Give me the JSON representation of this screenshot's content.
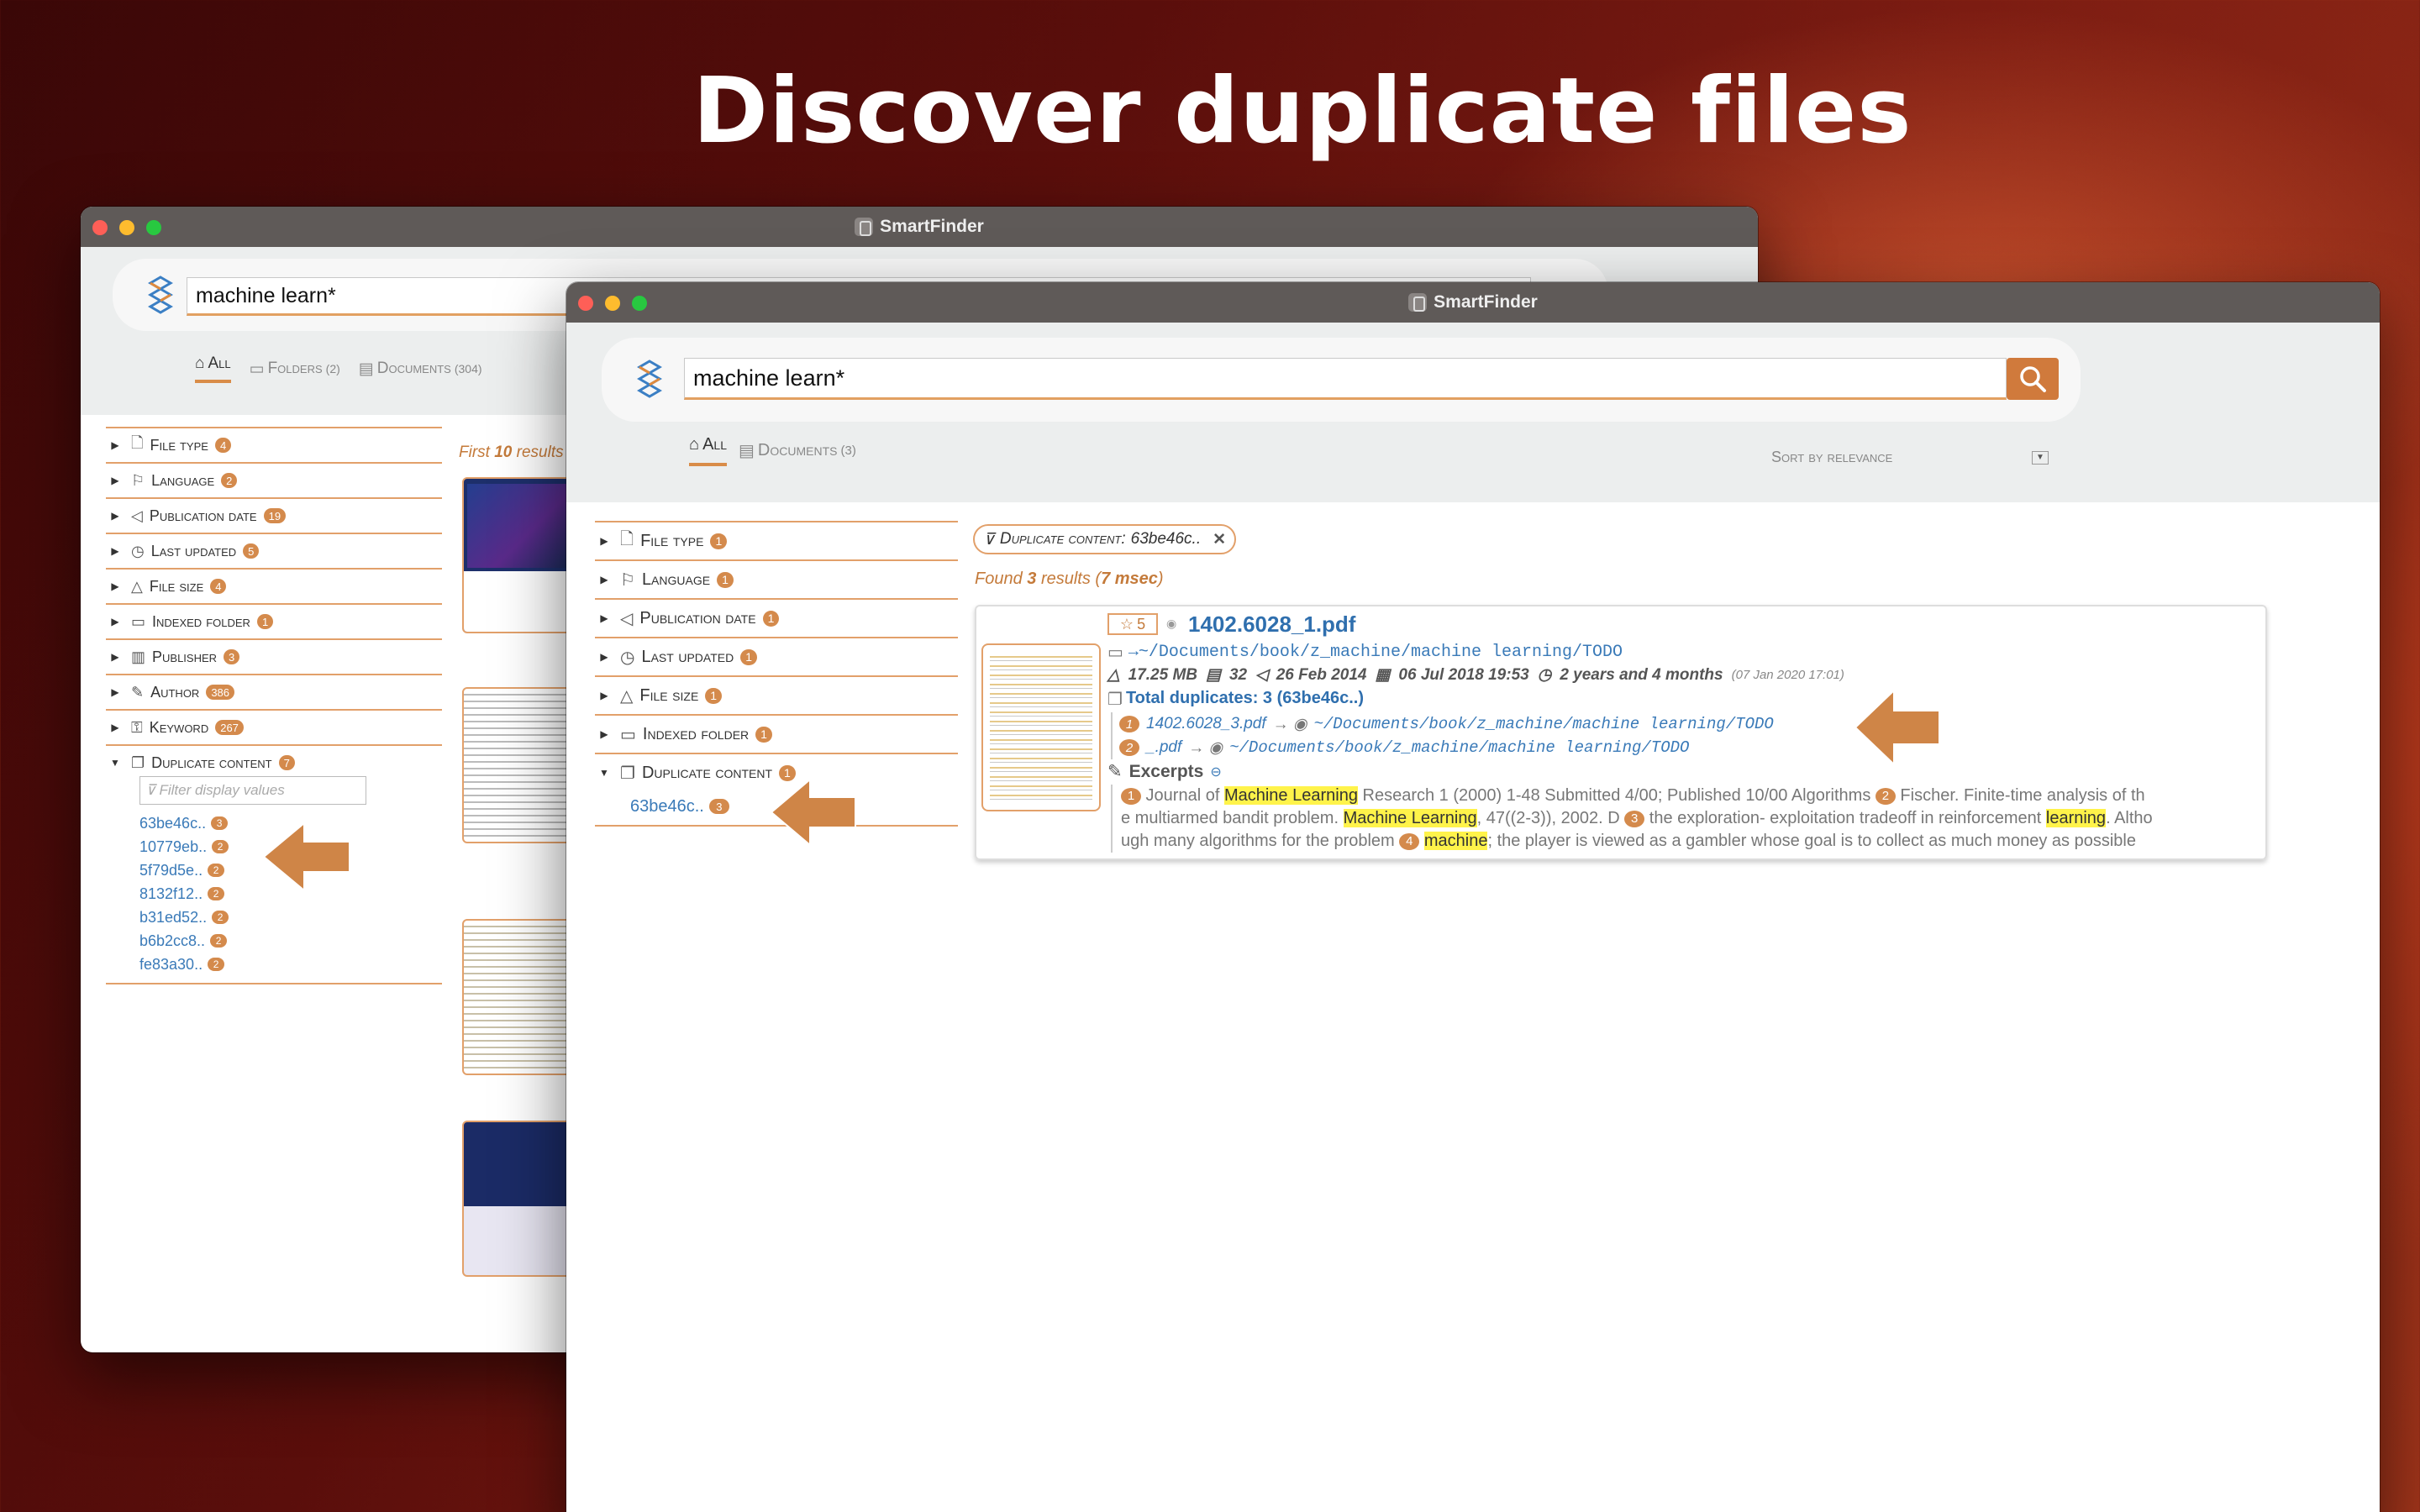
{
  "headline": "Discover duplicate files",
  "back_window": {
    "title": "SmartFinder",
    "search_value": "machine learn*",
    "tabs": [
      {
        "label": "All",
        "count": ""
      },
      {
        "label": "Folders",
        "count": "(2)"
      },
      {
        "label": "Documents",
        "count": "(304)"
      }
    ],
    "facets": [
      {
        "label": "File type",
        "count": "4",
        "icon": "file-icon"
      },
      {
        "label": "Language",
        "count": "2",
        "icon": "flag-icon"
      },
      {
        "label": "Publication date",
        "count": "19",
        "icon": "megaphone-icon"
      },
      {
        "label": "Last updated",
        "count": "5",
        "icon": "clock-icon"
      },
      {
        "label": "File size",
        "count": "4",
        "icon": "weight-icon"
      },
      {
        "label": "Indexed folder",
        "count": "1",
        "icon": "folder-icon"
      },
      {
        "label": "Publisher",
        "count": "3",
        "icon": "book-icon"
      },
      {
        "label": "Author",
        "count": "386",
        "icon": "pen-icon"
      },
      {
        "label": "Keyword",
        "count": "267",
        "icon": "key-icon"
      },
      {
        "label": "Duplicate content",
        "count": "7",
        "icon": "duplicate-icon"
      }
    ],
    "filter_placeholder": "Filter display values",
    "dup_values": [
      {
        "label": "63be46c..",
        "count": "3"
      },
      {
        "label": "10779eb..",
        "count": "2"
      },
      {
        "label": "5f79d5e..",
        "count": "2"
      },
      {
        "label": "8132f12..",
        "count": "2"
      },
      {
        "label": "b31ed52..",
        "count": "2"
      },
      {
        "label": "b6b2cc8..",
        "count": "2"
      },
      {
        "label": "fe83a30..",
        "count": "2"
      }
    ],
    "results_header_prefix": "First ",
    "results_header_count": "10",
    "results_header_suffix": " results"
  },
  "front_window": {
    "title": "SmartFinder",
    "search_value": "machine learn*",
    "sort_label": "Sort by relevance",
    "tabs": [
      {
        "label": "All",
        "count": ""
      },
      {
        "label": "Documents",
        "count": "(3)"
      }
    ],
    "facets": [
      {
        "label": "File type",
        "count": "1",
        "icon": "file-icon"
      },
      {
        "label": "Language",
        "count": "1",
        "icon": "flag-icon"
      },
      {
        "label": "Publication date",
        "count": "1",
        "icon": "megaphone-icon"
      },
      {
        "label": "Last updated",
        "count": "1",
        "icon": "clock-icon"
      },
      {
        "label": "File size",
        "count": "1",
        "icon": "weight-icon"
      },
      {
        "label": "Indexed folder",
        "count": "1",
        "icon": "folder-icon"
      },
      {
        "label": "Duplicate content",
        "count": "1",
        "icon": "duplicate-icon"
      }
    ],
    "dup_value": {
      "label": "63be46c..",
      "count": "3"
    },
    "filter_chip": {
      "label": "Duplicate content:",
      "value": "63be46c.."
    },
    "found": {
      "prefix": "Found ",
      "count": "3",
      "mid": " results (",
      "time": "7 msec",
      "suffix": ")"
    },
    "result": {
      "rating": "5",
      "title": "1402.6028_1.pdf",
      "path": "→~/Documents/book/z_machine/machine learning/TODO",
      "size": "17.25 MB",
      "pages": "32",
      "pub_date": "26 Feb 2014",
      "updated": "06 Jul 2018 19:53",
      "age": "2 years and 4 months",
      "age_date": "(07 Jan 2020 17:01)",
      "total_duplicates": "Total duplicates: 3 (63be46c..)",
      "dups": [
        {
          "num": "1",
          "name": "1402.6028_3.pdf",
          "path": "~/Documents/book/z_machine/machine learning/TODO"
        },
        {
          "num": "2",
          "name": "_.pdf",
          "path": "~/Documents/book/z_machine/machine learning/TODO"
        }
      ],
      "excerpts_label": "Excerpts",
      "excerpt_lines": [
        [
          {
            "t": "1",
            "n": true
          },
          {
            "t": " Journal of "
          },
          {
            "t": "Machine Learning",
            "h": true
          },
          {
            "t": " Research 1 (2000) 1-48 Submitted 4/00; Published 10/00 Algorithms "
          },
          {
            "t": "2",
            "n": true
          },
          {
            "t": " Fischer. Finite-time analysis of th"
          }
        ],
        [
          {
            "t": "e multiarmed bandit problem. "
          },
          {
            "t": "Machine Learning",
            "h": true
          },
          {
            "t": ", 47((2-3)), 2002. D "
          },
          {
            "t": "3",
            "n": true
          },
          {
            "t": " the exploration- exploitation tradeoff in reinforcement "
          },
          {
            "t": "learning",
            "h": true
          },
          {
            "t": ". Altho"
          }
        ],
        [
          {
            "t": "ugh many algorithms for the problem "
          },
          {
            "t": "4",
            "n": true
          },
          {
            "t": " "
          },
          {
            "t": "machine",
            "h": true
          },
          {
            "t": "; the player is viewed as a gambler whose goal is to collect as much money as possible"
          }
        ]
      ]
    }
  }
}
